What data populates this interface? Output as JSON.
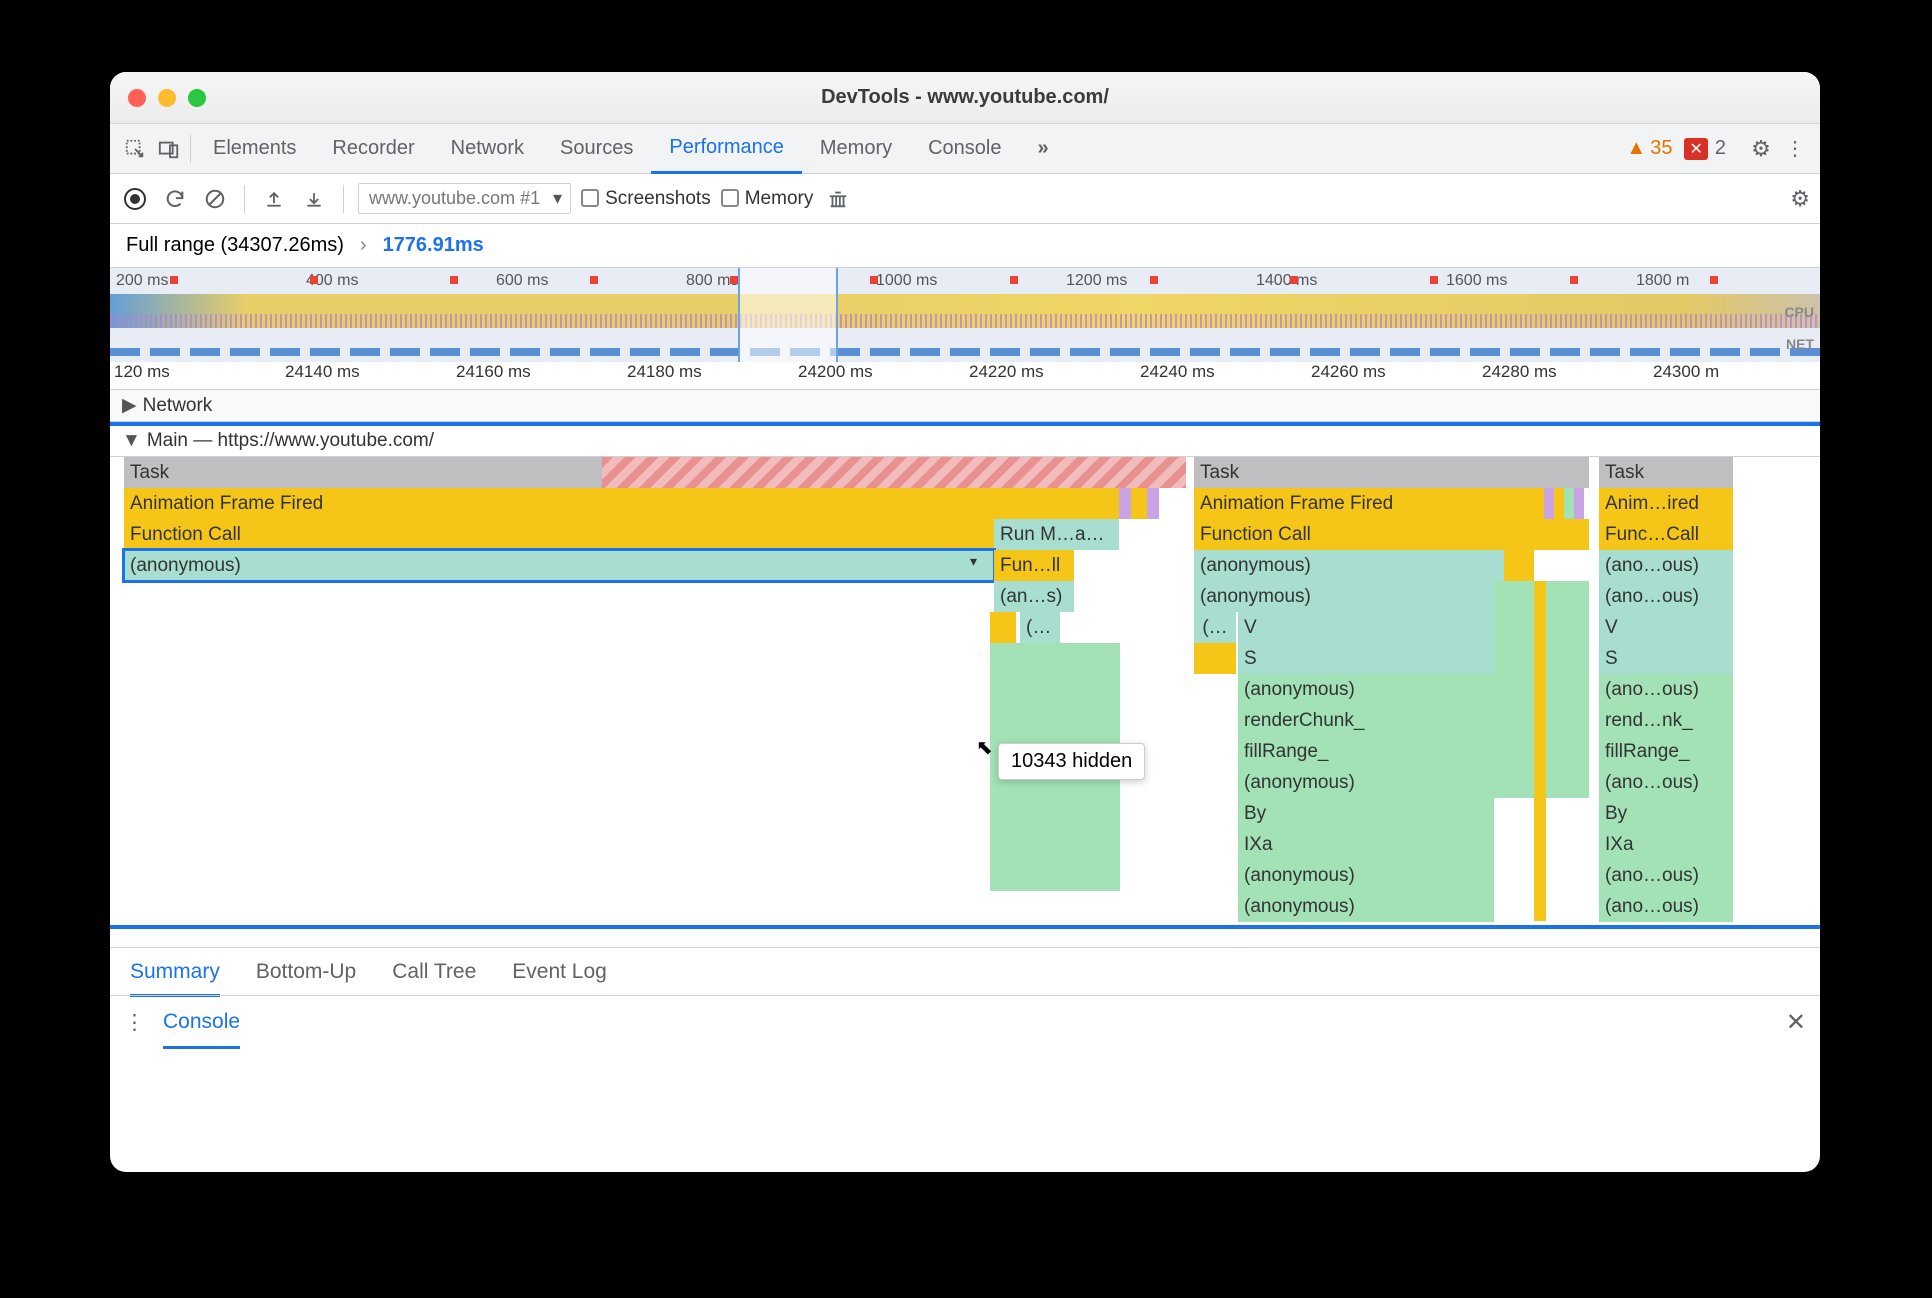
{
  "window": {
    "title": "DevTools - www.youtube.com/"
  },
  "mainTabs": {
    "items": [
      "Elements",
      "Recorder",
      "Network",
      "Sources",
      "Performance",
      "Memory",
      "Console"
    ],
    "activeIndex": 4,
    "more": "»"
  },
  "status": {
    "warnings": 35,
    "errors": 2
  },
  "toolbar": {
    "profileSelect": "www.youtube.com #1",
    "screenshots": "Screenshots",
    "memory": "Memory"
  },
  "breadcrumb": {
    "full": "Full range (34307.26ms)",
    "sep": "›",
    "current": "1776.91ms"
  },
  "overviewTicks": [
    "200 ms",
    "400 ms",
    "600 ms",
    "800 ms",
    "1000 ms",
    "1200 ms",
    "1400 ms",
    "1600 ms",
    "1800 m"
  ],
  "overviewLabels": {
    "cpu": "CPU",
    "net": "NET"
  },
  "rulerTicks": [
    "120 ms",
    "24140 ms",
    "24160 ms",
    "24180 ms",
    "24200 ms",
    "24220 ms",
    "24240 ms",
    "24260 ms",
    "24280 ms",
    "24300 m"
  ],
  "tracks": {
    "network": "Network",
    "main": "Main — https://www.youtube.com/"
  },
  "tooltip": "10343 hidden",
  "flame": {
    "col1": {
      "task": "Task",
      "aff": "Animation Frame Fired",
      "fc": "Function Call",
      "anon": "(anonymous)",
      "runm": "Run M…asks",
      "funll": "Fun…ll",
      "ans": "(an…s)",
      "p": "(…"
    },
    "col2": {
      "task": "Task",
      "aff": "Animation Frame Fired",
      "fc": "Function Call",
      "anon1": "(anonymous)",
      "anon2": "(anonymous)",
      "cell": "(…",
      "v": "V",
      "s": "S",
      "anon3": "(anonymous)",
      "render": "renderChunk_",
      "fill": "fillRange_",
      "anon4": "(anonymous)",
      "by": "By",
      "ixa": "IXa",
      "anon5": "(anonymous)",
      "anon6": "(anonymous)"
    },
    "col3": {
      "task": "Task",
      "aff": "Anim…ired",
      "fc": "Func…Call",
      "anon1": "(ano…ous)",
      "anon2": "(ano…ous)",
      "v": "V",
      "s": "S",
      "anon3": "(ano…ous)",
      "render": "rend…nk_",
      "fill": "fillRange_",
      "anon4": "(ano…ous)",
      "by": "By",
      "ixa": "IXa",
      "anon5": "(ano…ous)",
      "anon6": "(ano…ous)"
    }
  },
  "bottomTabs": {
    "items": [
      "Summary",
      "Bottom-Up",
      "Call Tree",
      "Event Log"
    ],
    "activeIndex": 0
  },
  "drawer": {
    "console": "Console"
  }
}
